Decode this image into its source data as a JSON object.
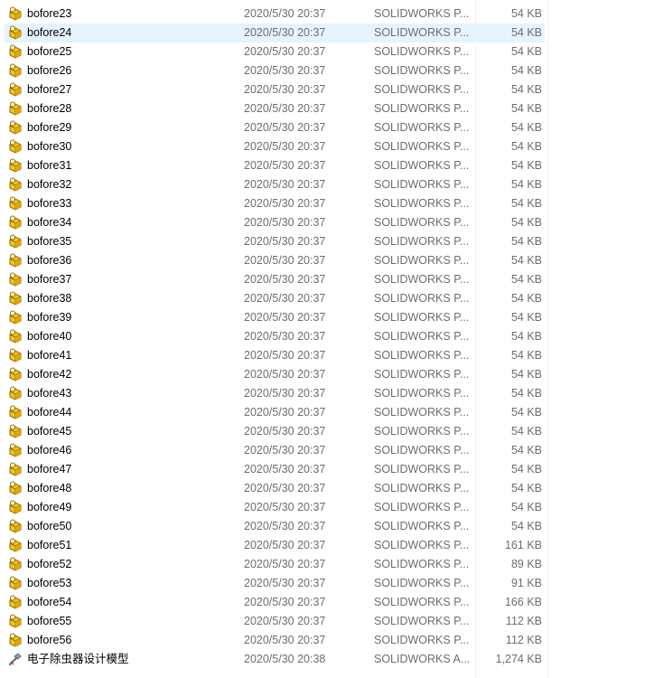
{
  "files": [
    {
      "name": "bofore23",
      "date": "2020/5/30 20:37",
      "type": "SOLIDWORKS P...",
      "size": "54 KB",
      "icon": "solidworks-part-icon"
    },
    {
      "name": "bofore24",
      "date": "2020/5/30 20:37",
      "type": "SOLIDWORKS P...",
      "size": "54 KB",
      "icon": "solidworks-part-icon",
      "selected": true
    },
    {
      "name": "bofore25",
      "date": "2020/5/30 20:37",
      "type": "SOLIDWORKS P...",
      "size": "54 KB",
      "icon": "solidworks-part-icon"
    },
    {
      "name": "bofore26",
      "date": "2020/5/30 20:37",
      "type": "SOLIDWORKS P...",
      "size": "54 KB",
      "icon": "solidworks-part-icon"
    },
    {
      "name": "bofore27",
      "date": "2020/5/30 20:37",
      "type": "SOLIDWORKS P...",
      "size": "54 KB",
      "icon": "solidworks-part-icon"
    },
    {
      "name": "bofore28",
      "date": "2020/5/30 20:37",
      "type": "SOLIDWORKS P...",
      "size": "54 KB",
      "icon": "solidworks-part-icon"
    },
    {
      "name": "bofore29",
      "date": "2020/5/30 20:37",
      "type": "SOLIDWORKS P...",
      "size": "54 KB",
      "icon": "solidworks-part-icon"
    },
    {
      "name": "bofore30",
      "date": "2020/5/30 20:37",
      "type": "SOLIDWORKS P...",
      "size": "54 KB",
      "icon": "solidworks-part-icon"
    },
    {
      "name": "bofore31",
      "date": "2020/5/30 20:37",
      "type": "SOLIDWORKS P...",
      "size": "54 KB",
      "icon": "solidworks-part-icon"
    },
    {
      "name": "bofore32",
      "date": "2020/5/30 20:37",
      "type": "SOLIDWORKS P...",
      "size": "54 KB",
      "icon": "solidworks-part-icon"
    },
    {
      "name": "bofore33",
      "date": "2020/5/30 20:37",
      "type": "SOLIDWORKS P...",
      "size": "54 KB",
      "icon": "solidworks-part-icon"
    },
    {
      "name": "bofore34",
      "date": "2020/5/30 20:37",
      "type": "SOLIDWORKS P...",
      "size": "54 KB",
      "icon": "solidworks-part-icon"
    },
    {
      "name": "bofore35",
      "date": "2020/5/30 20:37",
      "type": "SOLIDWORKS P...",
      "size": "54 KB",
      "icon": "solidworks-part-icon"
    },
    {
      "name": "bofore36",
      "date": "2020/5/30 20:37",
      "type": "SOLIDWORKS P...",
      "size": "54 KB",
      "icon": "solidworks-part-icon"
    },
    {
      "name": "bofore37",
      "date": "2020/5/30 20:37",
      "type": "SOLIDWORKS P...",
      "size": "54 KB",
      "icon": "solidworks-part-icon"
    },
    {
      "name": "bofore38",
      "date": "2020/5/30 20:37",
      "type": "SOLIDWORKS P...",
      "size": "54 KB",
      "icon": "solidworks-part-icon"
    },
    {
      "name": "bofore39",
      "date": "2020/5/30 20:37",
      "type": "SOLIDWORKS P...",
      "size": "54 KB",
      "icon": "solidworks-part-icon"
    },
    {
      "name": "bofore40",
      "date": "2020/5/30 20:37",
      "type": "SOLIDWORKS P...",
      "size": "54 KB",
      "icon": "solidworks-part-icon"
    },
    {
      "name": "bofore41",
      "date": "2020/5/30 20:37",
      "type": "SOLIDWORKS P...",
      "size": "54 KB",
      "icon": "solidworks-part-icon"
    },
    {
      "name": "bofore42",
      "date": "2020/5/30 20:37",
      "type": "SOLIDWORKS P...",
      "size": "54 KB",
      "icon": "solidworks-part-icon"
    },
    {
      "name": "bofore43",
      "date": "2020/5/30 20:37",
      "type": "SOLIDWORKS P...",
      "size": "54 KB",
      "icon": "solidworks-part-icon"
    },
    {
      "name": "bofore44",
      "date": "2020/5/30 20:37",
      "type": "SOLIDWORKS P...",
      "size": "54 KB",
      "icon": "solidworks-part-icon"
    },
    {
      "name": "bofore45",
      "date": "2020/5/30 20:37",
      "type": "SOLIDWORKS P...",
      "size": "54 KB",
      "icon": "solidworks-part-icon"
    },
    {
      "name": "bofore46",
      "date": "2020/5/30 20:37",
      "type": "SOLIDWORKS P...",
      "size": "54 KB",
      "icon": "solidworks-part-icon"
    },
    {
      "name": "bofore47",
      "date": "2020/5/30 20:37",
      "type": "SOLIDWORKS P...",
      "size": "54 KB",
      "icon": "solidworks-part-icon"
    },
    {
      "name": "bofore48",
      "date": "2020/5/30 20:37",
      "type": "SOLIDWORKS P...",
      "size": "54 KB",
      "icon": "solidworks-part-icon"
    },
    {
      "name": "bofore49",
      "date": "2020/5/30 20:37",
      "type": "SOLIDWORKS P...",
      "size": "54 KB",
      "icon": "solidworks-part-icon"
    },
    {
      "name": "bofore50",
      "date": "2020/5/30 20:37",
      "type": "SOLIDWORKS P...",
      "size": "54 KB",
      "icon": "solidworks-part-icon"
    },
    {
      "name": "bofore51",
      "date": "2020/5/30 20:37",
      "type": "SOLIDWORKS P...",
      "size": "161 KB",
      "icon": "solidworks-part-icon"
    },
    {
      "name": "bofore52",
      "date": "2020/5/30 20:37",
      "type": "SOLIDWORKS P...",
      "size": "89 KB",
      "icon": "solidworks-part-icon"
    },
    {
      "name": "bofore53",
      "date": "2020/5/30 20:37",
      "type": "SOLIDWORKS P...",
      "size": "91 KB",
      "icon": "solidworks-part-icon"
    },
    {
      "name": "bofore54",
      "date": "2020/5/30 20:37",
      "type": "SOLIDWORKS P...",
      "size": "166 KB",
      "icon": "solidworks-part-icon"
    },
    {
      "name": "bofore55",
      "date": "2020/5/30 20:37",
      "type": "SOLIDWORKS P...",
      "size": "112 KB",
      "icon": "solidworks-part-icon"
    },
    {
      "name": "bofore56",
      "date": "2020/5/30 20:37",
      "type": "SOLIDWORKS P...",
      "size": "112 KB",
      "icon": "solidworks-part-icon"
    },
    {
      "name": "电子除虫器设计模型",
      "date": "2020/5/30 20:38",
      "type": "SOLIDWORKS A...",
      "size": "1,274 KB",
      "icon": "solidworks-assembly-icon"
    }
  ],
  "colors": {
    "selected_bg": "#e5f3ff",
    "part_icon_fill": "#f5c518",
    "part_icon_stroke": "#8a6a00",
    "meta_text": "#6d6d6d"
  }
}
